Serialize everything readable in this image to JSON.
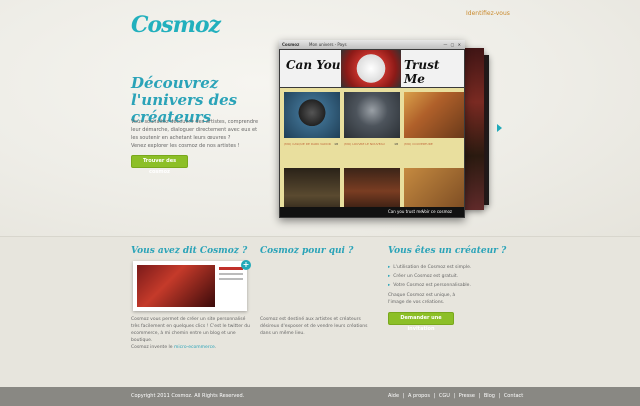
{
  "header": {
    "logo": "Cosmoz",
    "login_link": "Identifiez-vous"
  },
  "hero": {
    "title": "Découvrez l'univers des créateurs",
    "text": [
      "Vous souhaitez découvrir des artistes, comprendre leur démarche, dialoguer directement avec eux et les soutenir en achetant leurs œuvres ?",
      "Venez explorer les cosmoz de nos artistes !"
    ],
    "button": "Trouver des cosmoz"
  },
  "preview": {
    "browser_logo": "Cosmoz",
    "window_title": "Mon univers - Pays",
    "window_controls": "— ▢ ✕",
    "banner_left": "Can You",
    "banner_right": "Trust Me",
    "caption_left": "Can you trust me",
    "caption_right": "Voir ce cosmoz",
    "colors": {
      "banner_red": "#c0302a",
      "grid_bg": "#e9df9e"
    },
    "items": [
      {
        "label": "(MO) CASQUE DE DARK VADOR",
        "count": "18"
      },
      {
        "label": "(MO) LOUVRE LE NOUVEAU",
        "count": "18"
      },
      {
        "label": "(MO) COUVERTURE",
        "count": ""
      }
    ]
  },
  "columns": [
    {
      "title": "Vous avez dit Cosmoz ?",
      "text": "Cosmoz vous permet de créer un site personnalisé très facilement en quelques clics ! C'est le twitter du ecommerce, à mi chemin entre un blog et une boutique.",
      "link_prefix": "Cosmoz invente le ",
      "link": "micro-ecommerce",
      "link_suffix": "."
    },
    {
      "title": "Cosmoz pour qui ?",
      "text": "Cosmoz est destiné aux artistes et créateurs désireux d'exposer et de vendre leurs créations dans un même lieu."
    },
    {
      "title": "Vous êtes un créateur ?",
      "bullets": [
        "L'utilisation de Cosmoz est simple.",
        "Créer un Cosmoz est gratuit.",
        "Votre Cosmoz est personnalisable."
      ],
      "text": "Chaque Cosmoz est unique, à l'image de vos créations.",
      "button": "Demander une invitation"
    }
  ],
  "footer": {
    "copyright": "Copyright 2011 Cosmoz. All Rights Reserved.",
    "links": [
      "Aide",
      "A propos",
      "CGU",
      "Presse",
      "Blog",
      "Contact"
    ],
    "separator": "|"
  },
  "colors": {
    "accent": "#2aa3b8",
    "button": "#8cbf27",
    "footer": "#898883"
  }
}
